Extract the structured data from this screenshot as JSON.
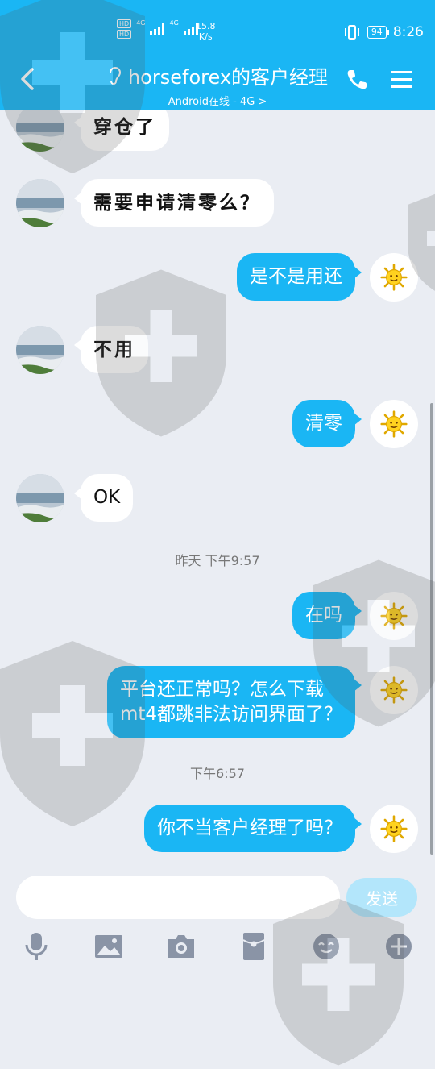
{
  "status_bar": {
    "hd1": "HD",
    "hd2": "HD",
    "net1": "4G",
    "net2": "4G",
    "speed_value": "15.8",
    "speed_unit": "K/s",
    "battery": "94",
    "time": "8:26"
  },
  "header": {
    "title": "horseforex的客户经理",
    "subtitle": "Android在线 - 4G >"
  },
  "messages": [
    {
      "side": "in",
      "text": "穿仓了"
    },
    {
      "side": "in",
      "text": "需要申请清零么？"
    },
    {
      "side": "out",
      "text": "是不是用还"
    },
    {
      "side": "in",
      "text": "不用"
    },
    {
      "side": "out",
      "text": "清零"
    },
    {
      "side": "in",
      "text": "OK"
    },
    {
      "side": "time",
      "text": "昨天 下午9:57"
    },
    {
      "side": "out",
      "text": "在吗"
    },
    {
      "side": "out",
      "text_line1": "平台还正常吗？怎么下载",
      "text_line2": "mt4都跳非法访问界面了？"
    },
    {
      "side": "time",
      "text": "下午6:57"
    },
    {
      "side": "out",
      "text": "你不当客户经理了吗？"
    }
  ],
  "input": {
    "value": "",
    "send_label": "发送"
  },
  "toolbar_icons": [
    "microphone-icon",
    "image-icon",
    "camera-icon",
    "red-packet-icon",
    "emoji-icon",
    "plus-icon"
  ],
  "colors": {
    "accent": "#1ab6f4",
    "background": "#eaedf3",
    "send_disabled": "#b3e6fb"
  }
}
